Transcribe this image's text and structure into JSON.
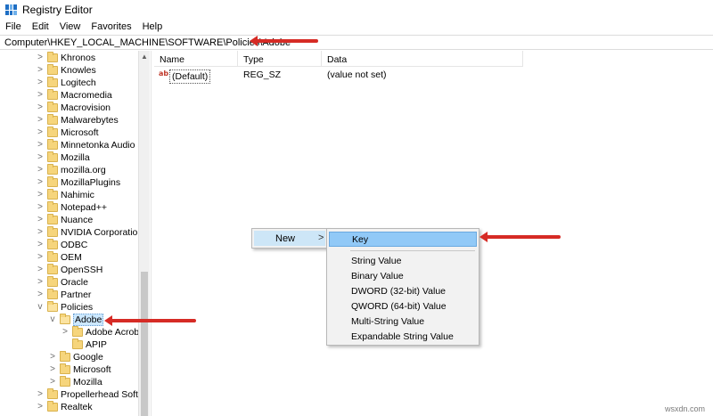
{
  "window": {
    "title": "Registry Editor"
  },
  "menu": [
    "File",
    "Edit",
    "View",
    "Favorites",
    "Help"
  ],
  "address": "Computer\\HKEY_LOCAL_MACHINE\\SOFTWARE\\Policies\\Adobe",
  "tree": [
    {
      "label": "Khronos",
      "chevron": ">"
    },
    {
      "label": "Knowles",
      "chevron": ">"
    },
    {
      "label": "Logitech",
      "chevron": ">"
    },
    {
      "label": "Macromedia",
      "chevron": ">"
    },
    {
      "label": "Macrovision",
      "chevron": ">"
    },
    {
      "label": "Malwarebytes",
      "chevron": ">"
    },
    {
      "label": "Microsoft",
      "chevron": ">"
    },
    {
      "label": "Minnetonka Audio S",
      "chevron": ">"
    },
    {
      "label": "Mozilla",
      "chevron": ">"
    },
    {
      "label": "mozilla.org",
      "chevron": ">"
    },
    {
      "label": "MozillaPlugins",
      "chevron": ">"
    },
    {
      "label": "Nahimic",
      "chevron": ">"
    },
    {
      "label": "Notepad++",
      "chevron": ">"
    },
    {
      "label": "Nuance",
      "chevron": ">"
    },
    {
      "label": "NVIDIA Corporation",
      "chevron": ">"
    },
    {
      "label": "ODBC",
      "chevron": ">"
    },
    {
      "label": "OEM",
      "chevron": ">"
    },
    {
      "label": "OpenSSH",
      "chevron": ">"
    },
    {
      "label": "Oracle",
      "chevron": ">"
    },
    {
      "label": "Partner",
      "chevron": ">"
    },
    {
      "label": "Policies",
      "chevron": "v"
    },
    {
      "label": "Adobe",
      "chevron": "v"
    },
    {
      "label": "Adobe Acroba",
      "chevron": ">"
    },
    {
      "label": "APIP",
      "chevron": ""
    },
    {
      "label": "Google",
      "chevron": ">"
    },
    {
      "label": "Microsoft",
      "chevron": ">"
    },
    {
      "label": "Mozilla",
      "chevron": ">"
    },
    {
      "label": "Propellerhead Softw",
      "chevron": ">"
    },
    {
      "label": "Realtek",
      "chevron": ">"
    }
  ],
  "columns": {
    "name": "Name",
    "type": "Type",
    "data": "Data"
  },
  "values": [
    {
      "icon": "ab",
      "name": "(Default)",
      "type": "REG_SZ",
      "data": "(value not set)"
    }
  ],
  "context_menu": {
    "new_label": "New",
    "new_arrow": ">",
    "submenu": [
      "Key",
      "String Value",
      "Binary Value",
      "DWORD (32-bit) Value",
      "QWORD (64-bit) Value",
      "Multi-String Value",
      "Expandable String Value"
    ]
  },
  "scroll_up_glyph": "▲",
  "watermark": "wsxdn.com",
  "colors": {
    "annotation_arrow": "#d62b25",
    "selection": "#cce8ff",
    "menu_highlight": "#91c9f7"
  }
}
